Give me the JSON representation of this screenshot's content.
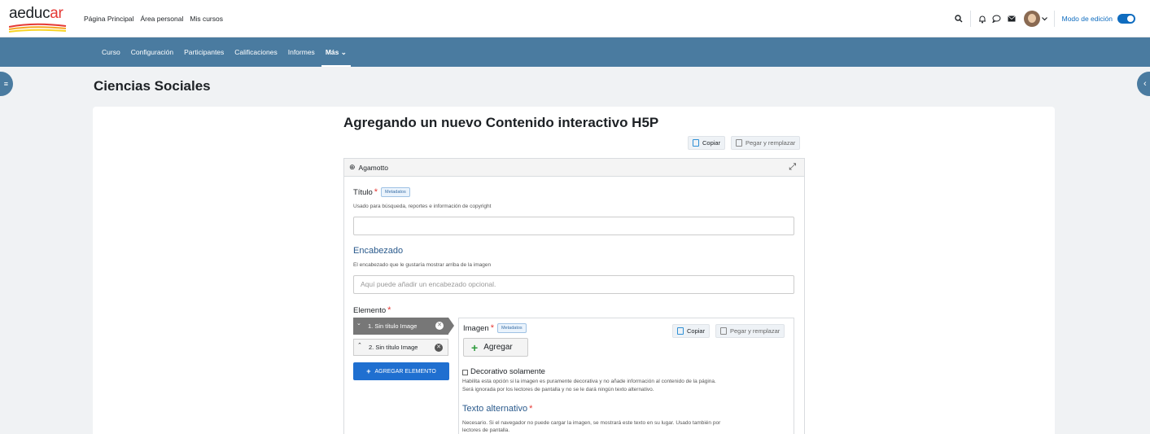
{
  "brand": {
    "logo_main": "aeduc",
    "logo_accent": "ar"
  },
  "topnav": {
    "items": [
      "Página Principal",
      "Área personal",
      "Mis cursos"
    ]
  },
  "user_area": {
    "edit_mode_label": "Modo de edición"
  },
  "secondary_nav": {
    "items": [
      "Curso",
      "Configuración",
      "Participantes",
      "Calificaciones",
      "Informes"
    ],
    "more_label": "Más"
  },
  "course": {
    "title": "Ciencias Sociales"
  },
  "page": {
    "heading": "Agregando un nuevo Contenido interactivo H5P"
  },
  "toolbar": {
    "copy_label": "Copiar",
    "paste_label": "Pegar y remplazar"
  },
  "editor": {
    "content_type": "Agamotto",
    "title_field": {
      "label": "Título",
      "metadata_label": "Metadatos",
      "help": "Usado para búsqueda, reportes e información de copyright",
      "value": ""
    },
    "heading_field": {
      "label": "Encabezado",
      "help": "El encabezado que le gustaría mostrar arriba de la imagen",
      "placeholder": "Aquí puede añadir un encabezado opcional."
    },
    "element_field": {
      "label": "Elemento",
      "items": [
        {
          "label": "1. Sin título Image"
        },
        {
          "label": "2. Sin título Image"
        }
      ],
      "add_button": "AGREGAR ELEMENTO"
    },
    "image_panel": {
      "label": "Imagen",
      "metadata_label": "Metadatos",
      "copy_label": "Copiar",
      "paste_label": "Pegar y remplazar",
      "add_label": "Agregar",
      "decorative_label": "Decorativo solamente",
      "decorative_help_1": "Habilita esta opción si la imagen es puramente decorativa y no añade información al contenido de la página.",
      "decorative_help_2": "Será ignorada por los lectores de pantalla y no se le dará ningún texto alternativo.",
      "alt_label": "Texto alternativo",
      "alt_help_1": "Necesario. Si el navegador no puede cargar la imagen, se mostrará este texto en su lugar. Usado también por",
      "alt_help_2": "lectores de pantalla."
    }
  },
  "colors": {
    "nav_bg": "#4a7ba0",
    "primary": "#1f6fd0",
    "required": "#e53935",
    "link": "#0f6cbf"
  }
}
